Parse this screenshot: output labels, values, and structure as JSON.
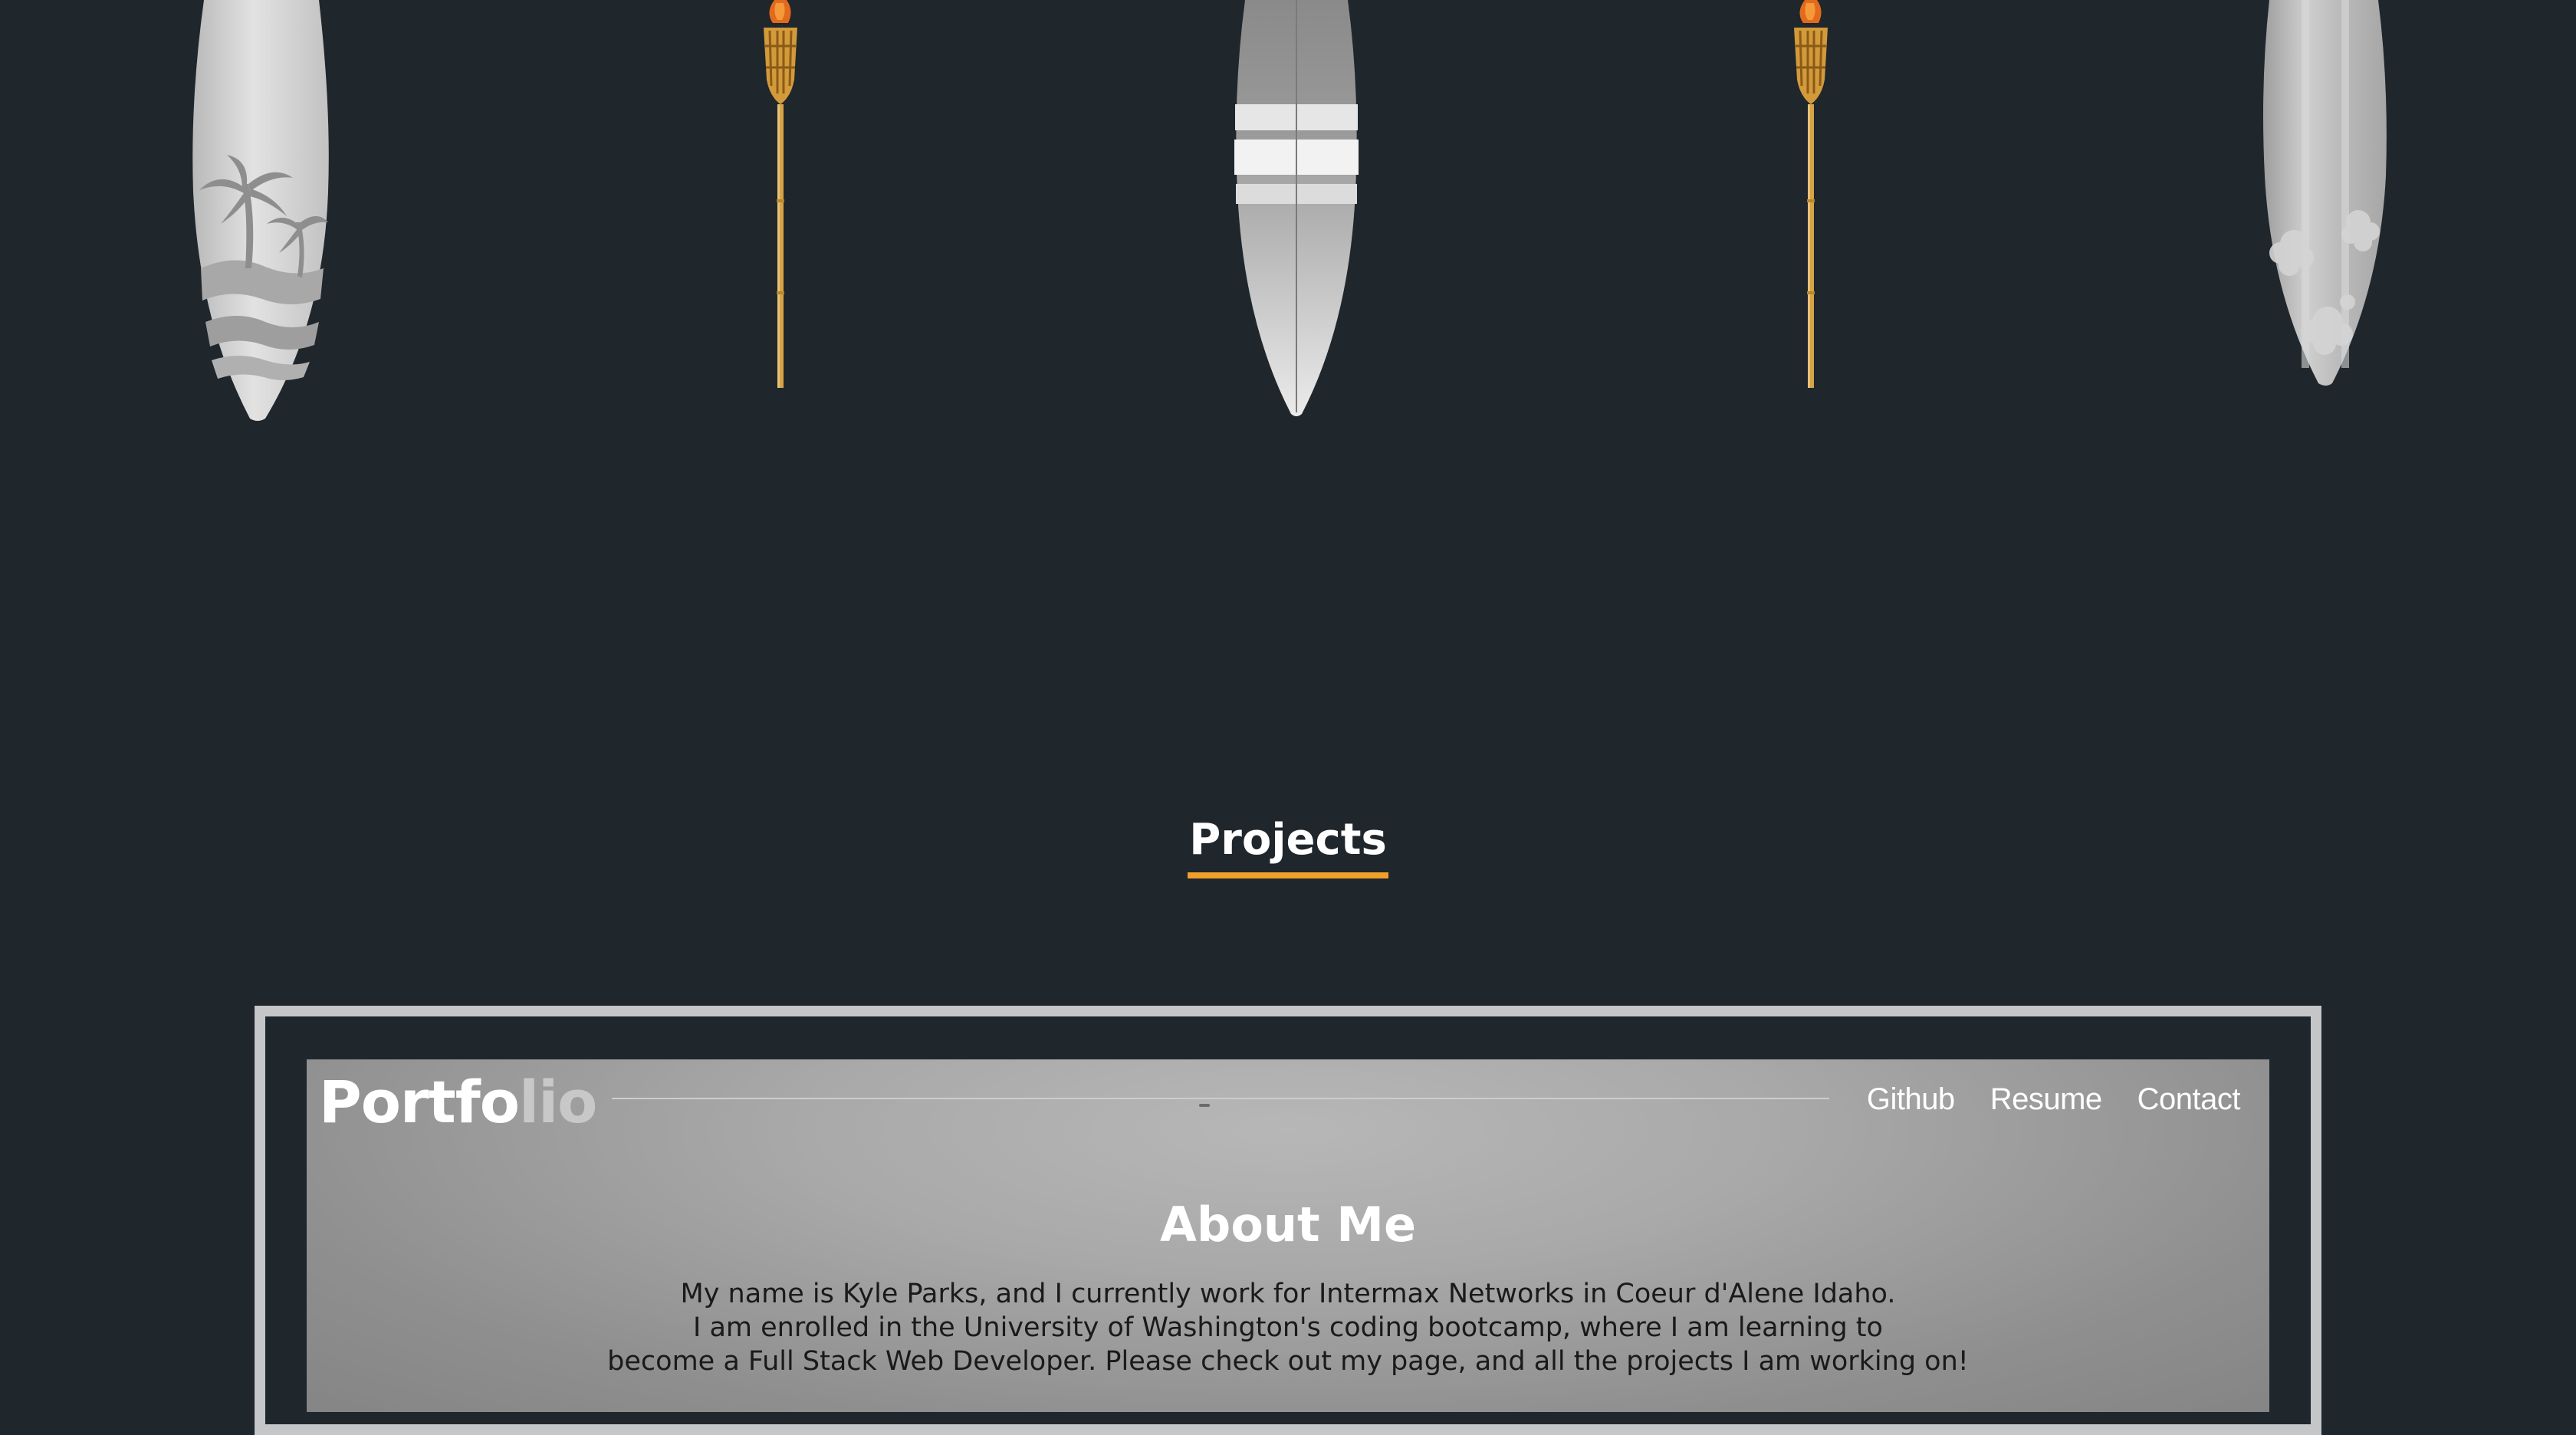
{
  "projects_section": {
    "heading": "Projects"
  },
  "decorations": [
    {
      "type": "surfboard",
      "icon": "surfboard-palm-icon"
    },
    {
      "type": "tiki-torch",
      "icon": "tiki-torch-icon"
    },
    {
      "type": "surfboard",
      "icon": "surfboard-striped-icon"
    },
    {
      "type": "tiki-torch",
      "icon": "tiki-torch-icon"
    },
    {
      "type": "surfboard",
      "icon": "surfboard-hibiscus-icon"
    }
  ],
  "preview": {
    "logo": {
      "main": "Portfo",
      "faded": "lio"
    },
    "nav": {
      "github": "Github",
      "resume": "Resume",
      "contact": "Contact"
    },
    "about": {
      "title": "About Me",
      "lines": [
        "My name is Kyle Parks, and I currently work for Intermax Networks in Coeur d'Alene Idaho.",
        "I am enrolled in the University of Washington's coding bootcamp, where I am learning to",
        "become a Full Stack Web Developer. Please check out my page, and all the projects I am working on!"
      ]
    }
  },
  "colors": {
    "page_background": "#1f262c",
    "accent_underline": "#f0a02a",
    "frame_border": "#c4c6c8",
    "heading_text": "#ffffff"
  }
}
